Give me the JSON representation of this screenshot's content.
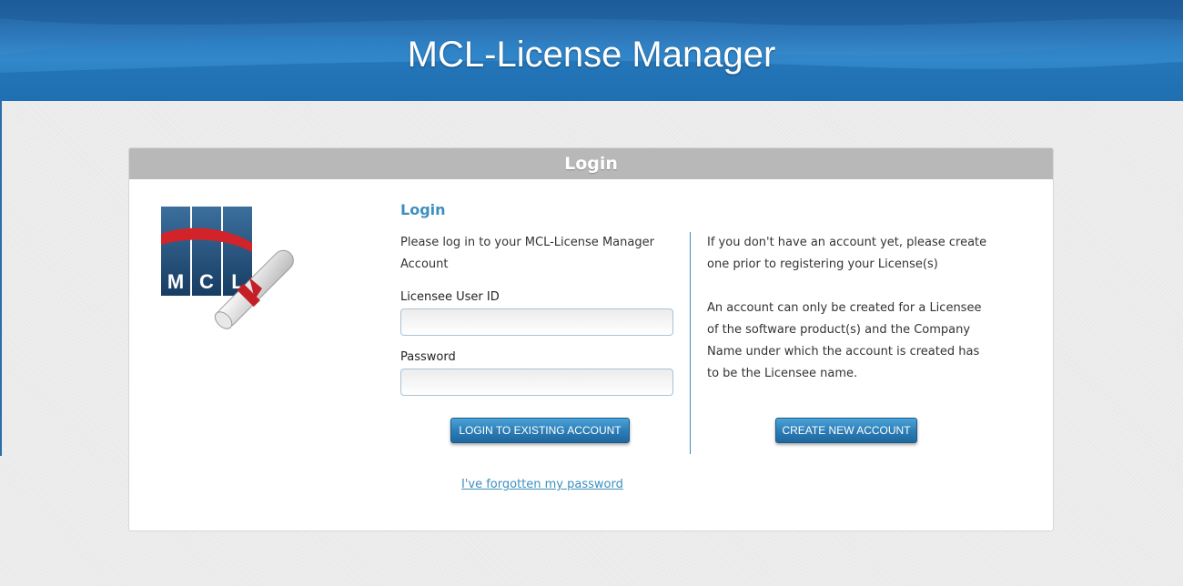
{
  "header": {
    "title": "MCL-License Manager"
  },
  "panel": {
    "heading": "Login"
  },
  "logo": {
    "letters": [
      "M",
      "C",
      "L"
    ]
  },
  "login": {
    "heading": "Login",
    "intro": "Please log in to your MCL-License Manager Account",
    "user_id_label": "Licensee User ID",
    "user_id_value": "",
    "password_label": "Password",
    "password_value": "",
    "submit_label": "LOGIN TO EXISTING ACCOUNT",
    "forgot_link": "I've forgotten my password"
  },
  "register": {
    "paragraph1": "If you don't have an account yet, please create one prior to registering your License(s)",
    "paragraph2": "An account can only be created for a Licensee of the software product(s) and the Company Name under which the account is created has to be the Licensee name.",
    "button_label": "CREATE NEW ACCOUNT"
  },
  "colors": {
    "header_blue": "#2f7bbd",
    "accent": "#3d8fc0",
    "panel_header": "#b8b8b8",
    "button_blue": "#2e7fb8",
    "logo_red": "#d2232a"
  }
}
